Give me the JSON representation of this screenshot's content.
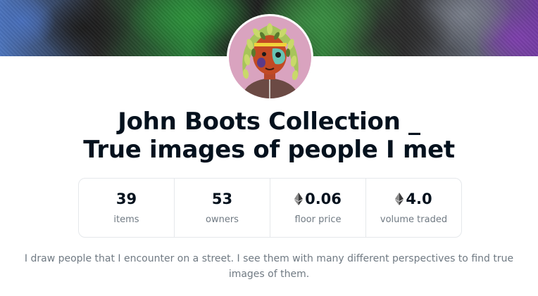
{
  "collection": {
    "title_line1": "John Boots Collection _",
    "title_line2": "True images of people I met",
    "description": "I draw people that I encounter on a street. I see them with many different perspectives to find true images of them."
  },
  "stats": [
    {
      "value": "39",
      "label": "items",
      "icon": ""
    },
    {
      "value": "53",
      "label": "owners",
      "icon": ""
    },
    {
      "value": "0.06",
      "label": "floor price",
      "icon": "eth-icon"
    },
    {
      "value": "4.0",
      "label": "volume traded",
      "icon": "eth-icon"
    }
  ]
}
